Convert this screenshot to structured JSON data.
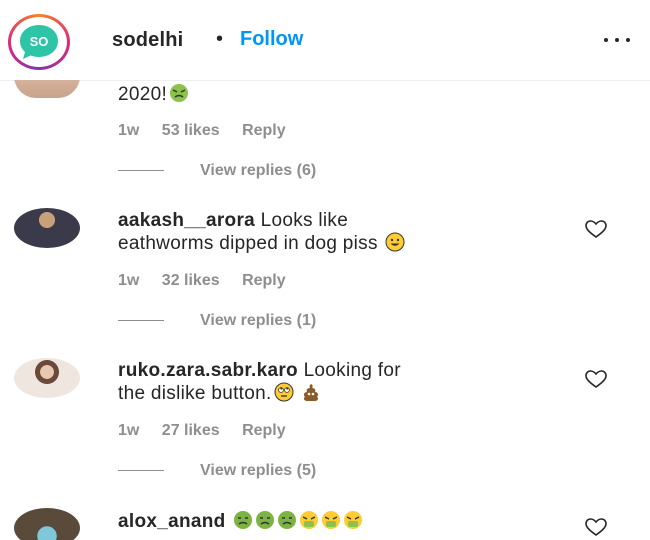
{
  "header": {
    "account": "sodelhi",
    "logo_text": "SO",
    "separator": "•",
    "follow_label": "Follow",
    "more_label": "more options"
  },
  "comments": [
    {
      "text_tail": "2020!",
      "emojis": [
        "nauseated-face"
      ],
      "time": "1w",
      "likes": "53 likes",
      "reply_label": "Reply",
      "view_replies": "View replies (6)"
    },
    {
      "username": "aakash__arora",
      "text_line1": "Looks like",
      "text_line2": "eathworms dipped in dog piss",
      "emojis": [
        "smiling-face"
      ],
      "time": "1w",
      "likes": "32 likes",
      "reply_label": "Reply",
      "view_replies": "View replies (1)"
    },
    {
      "username": "ruko.zara.sabr.karo",
      "text_line1": "Looking for",
      "text_line2": "the dislike button.",
      "emojis": [
        "face-with-rolling-eyes",
        "pile-of-poo"
      ],
      "time": "1w",
      "likes": "27 likes",
      "reply_label": "Reply",
      "view_replies": "View replies (5)"
    },
    {
      "username": "alox_anand",
      "emojis": [
        "nauseated-face",
        "nauseated-face",
        "nauseated-face",
        "face-vomiting",
        "face-vomiting",
        "face-vomiting"
      ]
    }
  ],
  "colors": {
    "follow": "#0095f6",
    "text": "#262626",
    "muted": "#8e8e8e",
    "logo_bg": "#2ec4a6"
  }
}
